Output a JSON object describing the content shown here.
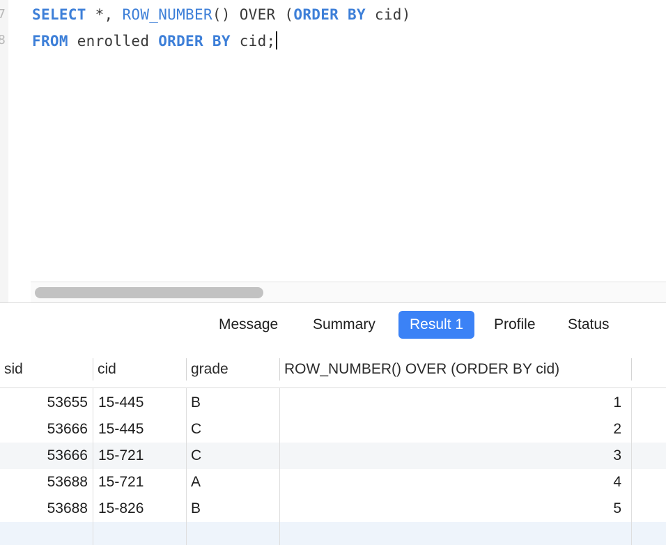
{
  "editor": {
    "line_numbers": [
      "7",
      "8"
    ],
    "line1": {
      "t1": "SELECT",
      "t2": " *, ",
      "t3": "ROW_NUMBER",
      "t4": "() OVER (",
      "t5": "ORDER BY",
      "t6": " cid)"
    },
    "line2": {
      "t1": "FROM",
      "t2": " enrolled ",
      "t3": "ORDER BY",
      "t4": " cid;"
    }
  },
  "tabs": [
    {
      "label": "Message"
    },
    {
      "label": "Summary"
    },
    {
      "label": "Result 1",
      "active": true
    },
    {
      "label": "Profile"
    },
    {
      "label": "Status"
    }
  ],
  "result": {
    "columns": [
      "sid",
      "cid",
      "grade",
      "ROW_NUMBER() OVER (ORDER BY cid)"
    ],
    "rows": [
      [
        "53655",
        "15-445",
        "B",
        "1"
      ],
      [
        "53666",
        "15-445",
        "C",
        "2"
      ],
      [
        "53666",
        "15-721",
        "C",
        "3"
      ],
      [
        "53688",
        "15-721",
        "A",
        "4"
      ],
      [
        "53688",
        "15-826",
        "B",
        "5"
      ]
    ]
  },
  "colors": {
    "keyword": "#3d7fd8",
    "active_tab": "#3b82f6",
    "stripe": "#f4f6f8"
  }
}
